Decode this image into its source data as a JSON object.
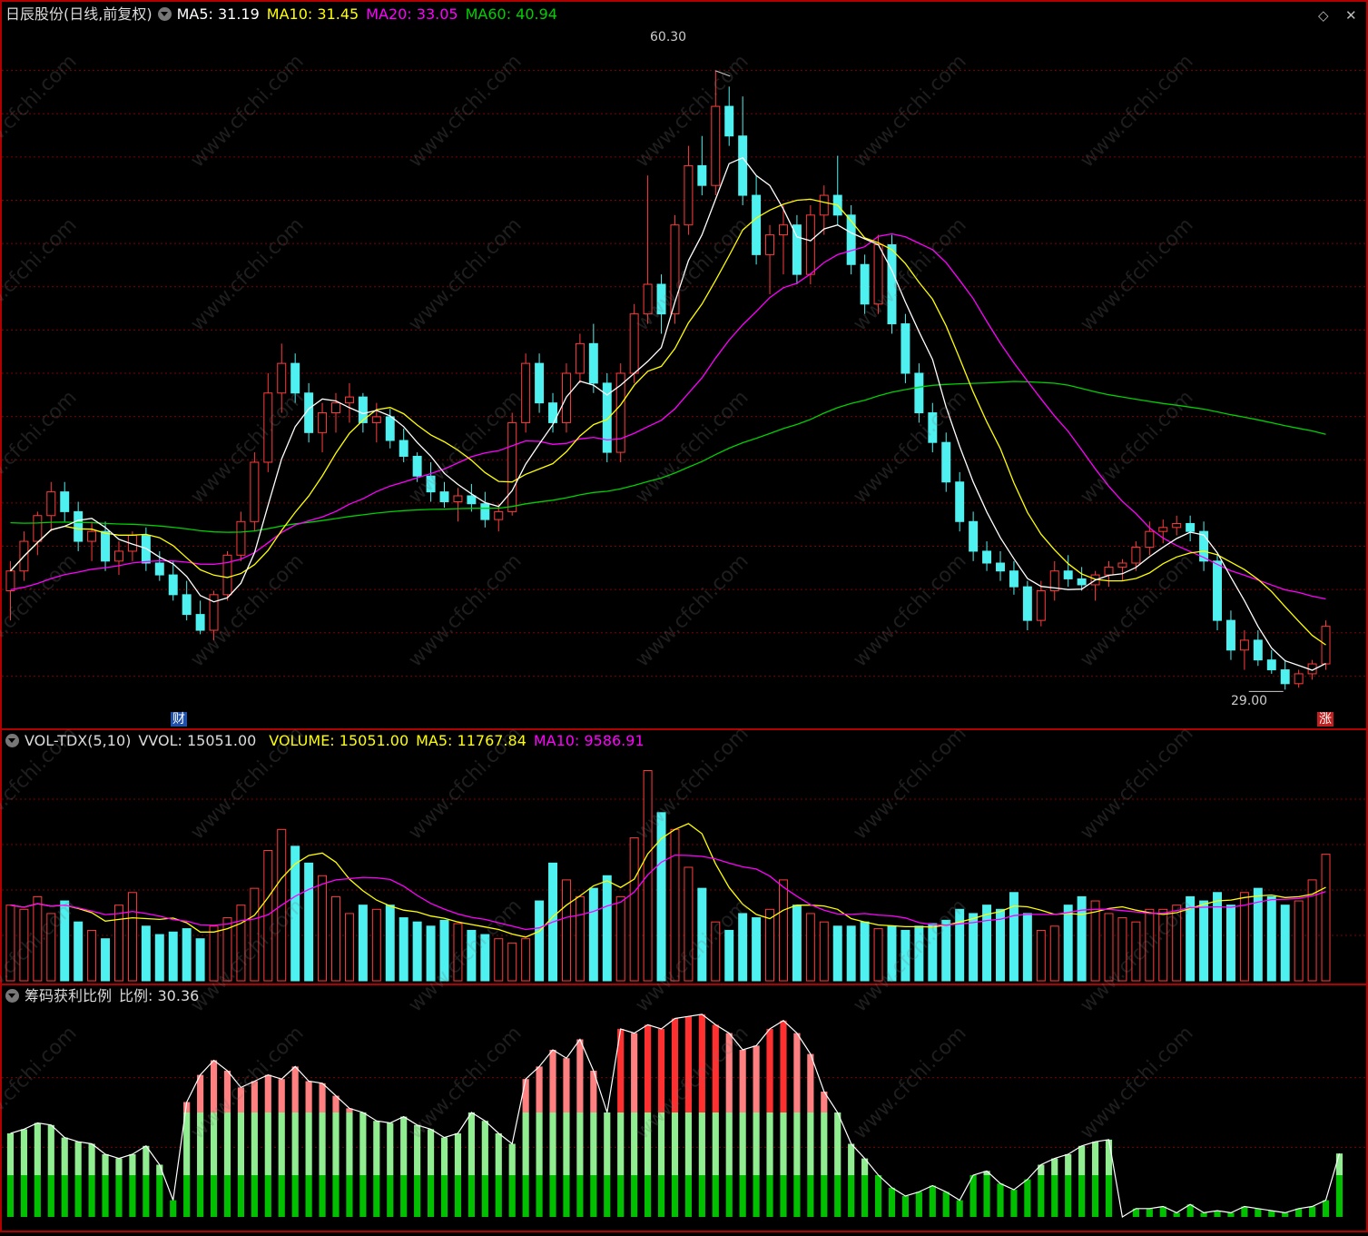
{
  "main_header": {
    "stock_title": "日辰股份(日线,前复权)",
    "ma5": "MA5: 31.19",
    "ma10": "MA10: 31.45",
    "ma20": "MA20: 33.05",
    "ma60": "MA60: 40.94"
  },
  "vol_header": {
    "name": "VOL-TDX(5,10)",
    "vvol": "VVOL: 15051.00",
    "volume": "VOLUME: 15051.00",
    "ma5": "MA5: 11767.84",
    "ma10": "MA10: 9586.91"
  },
  "chip_header": {
    "name": "筹码获利比例",
    "ratio": "比例: 30.36"
  },
  "markers": {
    "high_label": "60.30",
    "low_label": "29.00",
    "finance_tag": "财",
    "rise_tag": "涨"
  },
  "controls": {
    "diamond_icon": "◇",
    "close_icon": "✕"
  },
  "watermark": "www.cfchi.com",
  "colors": {
    "up": "#ff3b3b",
    "down": "#4ef0f0",
    "ma5": "#ffffff",
    "ma10": "#ffff00",
    "ma20": "#ff00ff",
    "ma60": "#00d000",
    "profit_high": "#ff8080",
    "profit_low": "#90ee90",
    "profit_base": "#00c000",
    "grid": "#800000"
  },
  "chart_data": [
    {
      "type": "candlestick",
      "title": "日辰股份(日线,前复权)",
      "y_high_marked": 60.3,
      "y_low_marked": 29.0,
      "ylim": [
        27.5,
        62.5
      ],
      "ohlc": [
        [
          34.0,
          35.5,
          32.5,
          35.0
        ],
        [
          35.0,
          37.0,
          34.5,
          36.5
        ],
        [
          36.5,
          38.0,
          35.8,
          37.8
        ],
        [
          37.8,
          39.5,
          37.0,
          39.0
        ],
        [
          39.0,
          39.5,
          37.5,
          38.0
        ],
        [
          38.0,
          38.5,
          36.0,
          36.5
        ],
        [
          36.5,
          37.5,
          35.5,
          37.0
        ],
        [
          37.0,
          37.5,
          35.0,
          35.5
        ],
        [
          35.5,
          36.5,
          34.8,
          36.0
        ],
        [
          36.0,
          37.0,
          35.5,
          36.8
        ],
        [
          36.8,
          37.2,
          35.0,
          35.4
        ],
        [
          35.4,
          36.0,
          34.5,
          34.8
        ],
        [
          34.8,
          35.5,
          33.5,
          33.8
        ],
        [
          33.8,
          34.5,
          32.5,
          32.8
        ],
        [
          32.8,
          33.5,
          31.8,
          32.0
        ],
        [
          32.0,
          34.0,
          31.5,
          33.8
        ],
        [
          33.8,
          36.0,
          33.5,
          35.8
        ],
        [
          35.8,
          38.0,
          35.5,
          37.5
        ],
        [
          37.5,
          41.0,
          37.0,
          40.5
        ],
        [
          40.5,
          45.0,
          40.0,
          44.0
        ],
        [
          44.0,
          46.5,
          43.0,
          45.5
        ],
        [
          45.5,
          46.0,
          43.5,
          44.0
        ],
        [
          44.0,
          44.5,
          41.5,
          42.0
        ],
        [
          42.0,
          43.5,
          41.0,
          43.0
        ],
        [
          43.0,
          44.0,
          42.0,
          43.5
        ],
        [
          43.5,
          44.5,
          42.5,
          43.8
        ],
        [
          43.8,
          44.0,
          42.0,
          42.5
        ],
        [
          42.5,
          43.5,
          41.5,
          42.8
        ],
        [
          42.8,
          43.2,
          41.2,
          41.6
        ],
        [
          41.6,
          42.2,
          40.5,
          40.8
        ],
        [
          40.8,
          41.0,
          39.5,
          39.8
        ],
        [
          39.8,
          40.5,
          38.5,
          39.0
        ],
        [
          39.0,
          39.5,
          38.2,
          38.5
        ],
        [
          38.5,
          39.2,
          37.5,
          38.8
        ],
        [
          38.8,
          39.4,
          38.0,
          38.4
        ],
        [
          38.4,
          39.0,
          37.2,
          37.6
        ],
        [
          37.6,
          38.4,
          37.0,
          38.0
        ],
        [
          38.0,
          43.0,
          37.8,
          42.5
        ],
        [
          42.5,
          46.0,
          42.0,
          45.5
        ],
        [
          45.5,
          46.0,
          43.0,
          43.5
        ],
        [
          43.5,
          44.0,
          42.0,
          42.5
        ],
        [
          42.5,
          45.5,
          42.0,
          45.0
        ],
        [
          45.0,
          47.0,
          44.5,
          46.5
        ],
        [
          46.5,
          47.5,
          44.0,
          44.5
        ],
        [
          44.5,
          45.0,
          40.5,
          41.0
        ],
        [
          41.0,
          45.5,
          40.5,
          45.0
        ],
        [
          45.0,
          48.5,
          44.5,
          48.0
        ],
        [
          48.0,
          55.0,
          47.5,
          49.5
        ],
        [
          49.5,
          50.0,
          47.0,
          48.0
        ],
        [
          48.0,
          53.0,
          47.5,
          52.5
        ],
        [
          52.5,
          56.5,
          52.0,
          55.5
        ],
        [
          55.5,
          57.0,
          54.0,
          54.5
        ],
        [
          54.5,
          60.3,
          54.0,
          58.5
        ],
        [
          58.5,
          59.5,
          56.5,
          57.0
        ],
        [
          57.0,
          59.0,
          53.5,
          54.0
        ],
        [
          54.0,
          55.0,
          50.5,
          51.0
        ],
        [
          51.0,
          52.5,
          49.0,
          52.0
        ],
        [
          52.0,
          53.5,
          50.0,
          52.5
        ],
        [
          52.5,
          53.0,
          49.5,
          50.0
        ],
        [
          50.0,
          53.5,
          49.5,
          53.0
        ],
        [
          53.0,
          54.5,
          52.0,
          54.0
        ],
        [
          54.0,
          56.0,
          52.5,
          53.0
        ],
        [
          53.0,
          53.5,
          50.0,
          50.5
        ],
        [
          50.5,
          51.0,
          48.0,
          48.5
        ],
        [
          48.5,
          52.0,
          48.0,
          51.5
        ],
        [
          51.5,
          52.0,
          47.0,
          47.5
        ],
        [
          47.5,
          48.0,
          44.5,
          45.0
        ],
        [
          45.0,
          45.5,
          42.5,
          43.0
        ],
        [
          43.0,
          43.5,
          41.0,
          41.5
        ],
        [
          41.5,
          42.0,
          39.0,
          39.5
        ],
        [
          39.5,
          40.0,
          37.0,
          37.5
        ],
        [
          37.5,
          38.0,
          35.5,
          36.0
        ],
        [
          36.0,
          36.5,
          35.0,
          35.4
        ],
        [
          35.4,
          36.0,
          34.5,
          35.0
        ],
        [
          35.0,
          35.5,
          33.8,
          34.2
        ],
        [
          34.2,
          34.5,
          32.0,
          32.5
        ],
        [
          32.5,
          34.5,
          32.2,
          34.0
        ],
        [
          34.0,
          35.5,
          33.5,
          35.0
        ],
        [
          35.0,
          35.8,
          34.2,
          34.6
        ],
        [
          34.6,
          35.2,
          34.0,
          34.3
        ],
        [
          34.3,
          35.0,
          33.5,
          34.8
        ],
        [
          34.8,
          35.5,
          34.2,
          35.2
        ],
        [
          35.2,
          35.6,
          34.5,
          35.4
        ],
        [
          35.4,
          36.5,
          35.0,
          36.2
        ],
        [
          36.2,
          37.5,
          35.8,
          37.0
        ],
        [
          37.0,
          37.6,
          36.4,
          37.2
        ],
        [
          37.2,
          37.8,
          36.8,
          37.4
        ],
        [
          37.4,
          37.8,
          36.5,
          37.0
        ],
        [
          37.0,
          37.5,
          35.0,
          35.5
        ],
        [
          35.5,
          35.8,
          32.0,
          32.5
        ],
        [
          32.5,
          33.0,
          30.5,
          31.0
        ],
        [
          31.0,
          32.0,
          30.0,
          31.5
        ],
        [
          31.5,
          32.0,
          30.2,
          30.5
        ],
        [
          30.5,
          31.0,
          29.8,
          30.0
        ],
        [
          30.0,
          30.5,
          29.0,
          29.3
        ],
        [
          29.3,
          30.0,
          29.1,
          29.8
        ],
        [
          29.8,
          30.5,
          29.5,
          30.3
        ],
        [
          30.3,
          32.5,
          30.0,
          32.2
        ]
      ]
    },
    {
      "type": "bar",
      "title": "VOL-TDX(5,10)",
      "last_volume": 15051.0,
      "ma5_last": 11767.84,
      "ma10_last": 9586.91,
      "values": [
        9000,
        8500,
        10000,
        8000,
        9500,
        7000,
        6000,
        5000,
        9000,
        10500,
        6500,
        5500,
        5800,
        6200,
        5000,
        6500,
        7500,
        9000,
        11000,
        15500,
        18000,
        16000,
        14000,
        12500,
        10000,
        8000,
        9000,
        8500,
        9000,
        7500,
        7000,
        6500,
        7200,
        6800,
        6000,
        5500,
        5000,
        4500,
        5000,
        9500,
        14000,
        12000,
        10000,
        11000,
        12500,
        10000,
        17000,
        25000,
        20000,
        18000,
        13500,
        11000,
        7000,
        6000,
        8000,
        7500,
        8500,
        12000,
        9000,
        8000,
        7000,
        6500,
        6500,
        7000,
        6200,
        6500,
        6000,
        6500,
        6800,
        7200,
        8500,
        8000,
        9000,
        8500,
        10500,
        8000,
        6000,
        6500,
        9000,
        10000,
        9500,
        8000,
        7500,
        7000,
        8500,
        8500,
        9000,
        10000,
        9500,
        10500,
        9000,
        10500,
        11000,
        10000,
        9000,
        9500,
        12000,
        15051
      ]
    },
    {
      "type": "bar",
      "title": "筹码获利比例",
      "last_value": 30.36,
      "ylim": [
        0,
        100
      ],
      "values": [
        40,
        42,
        45,
        44,
        38,
        36,
        35,
        30,
        28,
        30,
        34,
        25,
        8,
        55,
        68,
        75,
        70,
        62,
        65,
        68,
        66,
        72,
        65,
        64,
        58,
        52,
        50,
        46,
        45,
        48,
        44,
        42,
        38,
        40,
        50,
        46,
        40,
        35,
        66,
        72,
        80,
        76,
        85,
        70,
        50,
        90,
        88,
        92,
        90,
        95,
        96,
        97,
        92,
        88,
        80,
        82,
        90,
        94,
        88,
        78,
        60,
        50,
        35,
        28,
        20,
        14,
        10,
        12,
        15,
        12,
        8,
        20,
        22,
        16,
        13,
        18,
        25,
        28,
        30,
        34,
        36,
        37,
        0,
        4,
        4,
        5,
        2,
        6,
        2,
        3,
        2,
        5,
        4,
        3,
        2,
        4,
        5,
        8,
        30.36
      ]
    }
  ]
}
